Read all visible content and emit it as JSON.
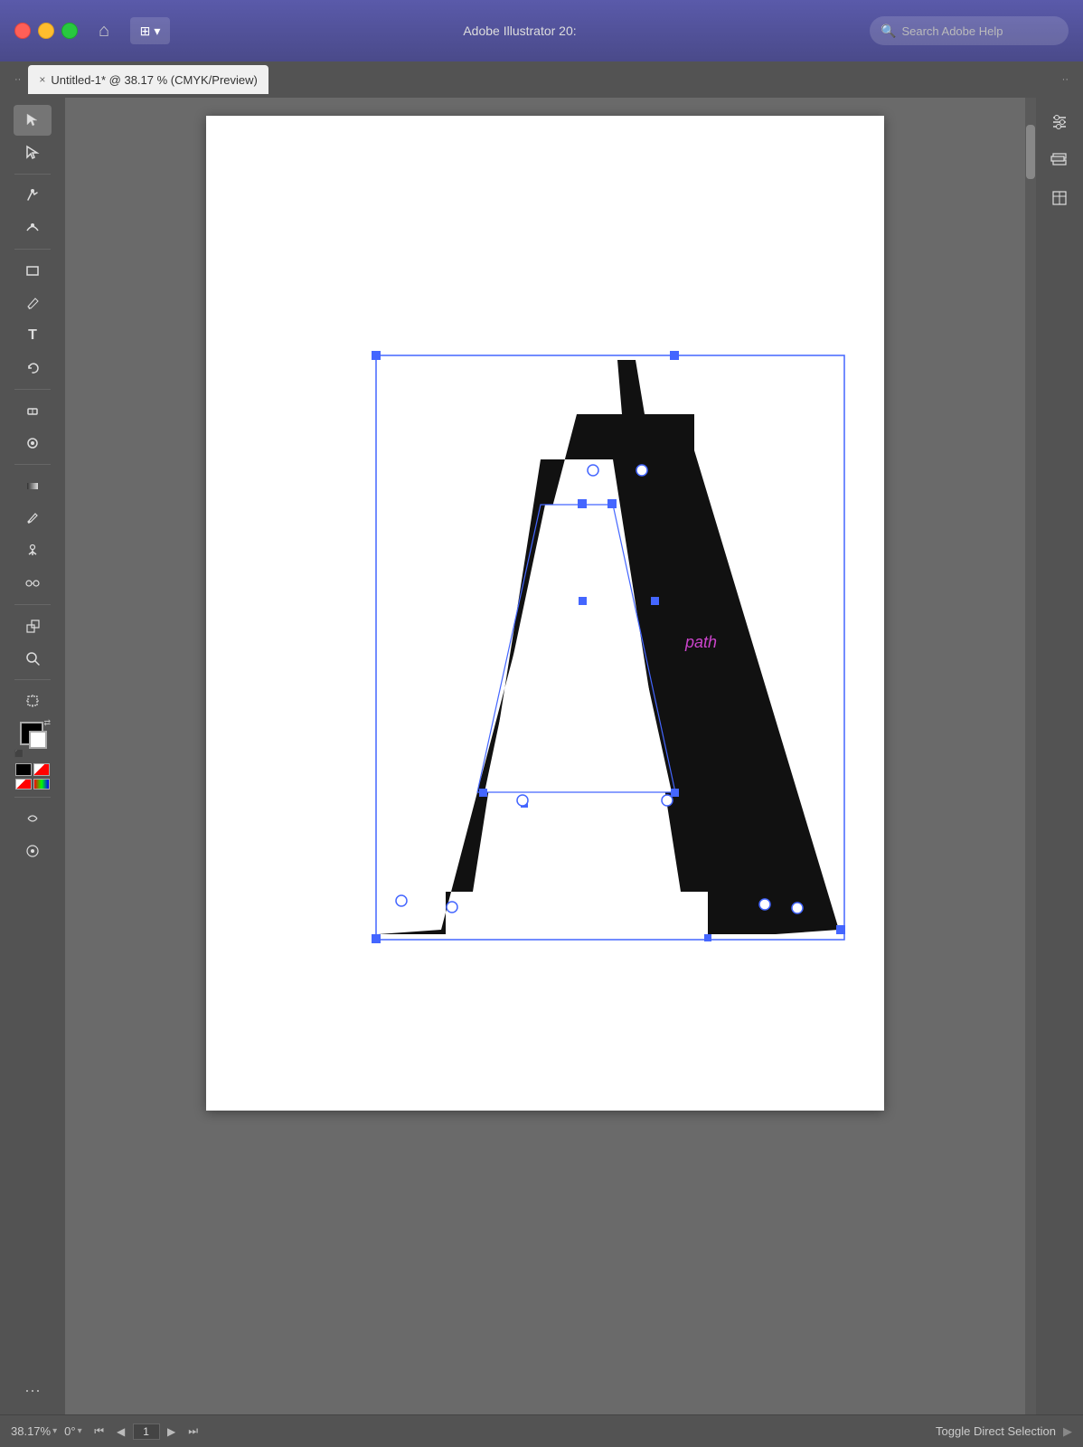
{
  "titlebar": {
    "app_title": "Adobe Illustrator 20:",
    "help_placeholder": "Search Adobe Help",
    "workspace_icon": "⊞",
    "chevron": "▾"
  },
  "tab": {
    "close_label": "×",
    "title": "Untitled-1* @ 38.17 % (CMYK/Preview)",
    "collapse_left": "··",
    "collapse_right": "··"
  },
  "tools": [
    {
      "name": "selection",
      "icon": "↖",
      "tooltip": "Selection Tool"
    },
    {
      "name": "direct-selection",
      "icon": "↗",
      "tooltip": "Direct Selection Tool"
    },
    {
      "name": "pen",
      "icon": "✒",
      "tooltip": "Pen Tool"
    },
    {
      "name": "curvature",
      "icon": "⌒",
      "tooltip": "Curvature Tool"
    },
    {
      "name": "rectangle",
      "icon": "□",
      "tooltip": "Rectangle Tool"
    },
    {
      "name": "pencil",
      "icon": "✏",
      "tooltip": "Pencil Tool"
    },
    {
      "name": "type",
      "icon": "T",
      "tooltip": "Type Tool"
    },
    {
      "name": "rotate",
      "icon": "↺",
      "tooltip": "Rotate Tool"
    },
    {
      "name": "eraser",
      "icon": "◈",
      "tooltip": "Eraser Tool"
    },
    {
      "name": "blob-brush",
      "icon": "◉",
      "tooltip": "Blob Brush Tool"
    },
    {
      "name": "gradient",
      "icon": "◧",
      "tooltip": "Gradient Tool"
    },
    {
      "name": "eyedropper",
      "icon": "🔬",
      "tooltip": "Eyedropper Tool"
    },
    {
      "name": "puppet-warp",
      "icon": "✱",
      "tooltip": "Puppet Warp Tool"
    },
    {
      "name": "blend",
      "icon": "⊕",
      "tooltip": "Blend Tool"
    },
    {
      "name": "shapebuilder",
      "icon": "◱",
      "tooltip": "Shape Builder Tool"
    },
    {
      "name": "zoom",
      "icon": "⌕",
      "tooltip": "Zoom Tool"
    },
    {
      "name": "artboard",
      "icon": "◫",
      "tooltip": "Artboard Tool"
    },
    {
      "name": "rotate2",
      "icon": "↻",
      "tooltip": "Redo"
    }
  ],
  "right_panel": {
    "properties_icon": "≡",
    "layers_icon": "◨",
    "libraries_icon": "□"
  },
  "statusbar": {
    "zoom": "38.17%",
    "rotation": "0°",
    "page": "1",
    "status_text": "Toggle Direct Selection"
  },
  "artboard": {
    "path_label": "path"
  },
  "colors": {
    "selection_blue": "#4466ff",
    "path_purple": "#cc44cc"
  }
}
